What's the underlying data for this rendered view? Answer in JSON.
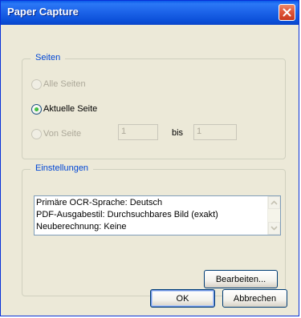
{
  "window": {
    "title": "Paper Capture"
  },
  "pages_group": {
    "legend": "Seiten",
    "options": [
      {
        "label": "Alle Seiten",
        "checked": false,
        "enabled": false
      },
      {
        "label": "Aktuelle Seite",
        "checked": true,
        "enabled": true
      },
      {
        "label": "Von Seite",
        "checked": false,
        "enabled": false
      }
    ],
    "from_value": "1",
    "to_label": "bis",
    "to_value": "1"
  },
  "settings_group": {
    "legend": "Einstellungen",
    "lines": [
      "Primäre OCR-Sprache: Deutsch",
      "PDF-Ausgabestil: Durchsuchbares Bild (exakt)",
      "Neuberechnung: Keine"
    ],
    "edit_label": "Bearbeiten..."
  },
  "buttons": {
    "ok": "OK",
    "cancel": "Abbrechen"
  },
  "colors": {
    "title_bar": "#0a5ae8",
    "legend_text": "#0046d5",
    "dialog_bg": "#ece9d8",
    "close_button": "#e0563a"
  }
}
